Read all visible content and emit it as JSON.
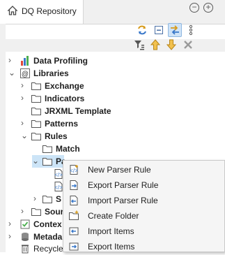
{
  "tab": {
    "title": "DQ Repository",
    "icon": "repository-home-icon"
  },
  "window_controls": {
    "minimize": "minimize-icon",
    "maximize": "maximize-icon"
  },
  "toolbar": {
    "icons": [
      "sync-icon",
      "collapse-all-icon",
      "link-with-editor-icon",
      "view-menu-icon"
    ]
  },
  "filter_bar": {
    "icons": [
      "filter-icon",
      "move-up-icon",
      "move-down-icon",
      "clear-icon"
    ]
  },
  "tree": {
    "data_profiling": "Data Profiling",
    "libraries": "Libraries",
    "exchange": "Exchange",
    "indicators": "Indicators",
    "jrxml_template": "JRXML Template",
    "patterns": "Patterns",
    "rules": "Rules",
    "match": "Match",
    "parser": "Pa",
    "sub_partial": "S",
    "source_partial": "Sour",
    "context_partial": "Contex",
    "metadata_partial": "Metada",
    "recycle_partial": "Recycle"
  },
  "context_menu": {
    "items": [
      {
        "label": "New Parser Rule",
        "icon": "new-parser-rule-icon"
      },
      {
        "label": "Export Parser Rule",
        "icon": "export-parser-rule-icon"
      },
      {
        "label": "Import Parser Rule",
        "icon": "import-parser-rule-icon"
      },
      {
        "label": "Create Folder",
        "icon": "create-folder-icon"
      },
      {
        "label": "Import Items",
        "icon": "import-items-icon"
      },
      {
        "label": "Export Items",
        "icon": "export-items-icon"
      }
    ]
  }
}
